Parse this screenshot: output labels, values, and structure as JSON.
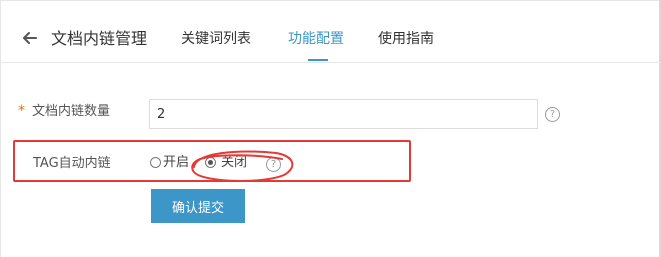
{
  "header": {
    "title": "文档内链管理",
    "tabs": [
      {
        "label": "关键词列表"
      },
      {
        "label": "功能配置"
      },
      {
        "label": "使用指南"
      }
    ]
  },
  "form": {
    "link_count": {
      "required_mark": "*",
      "label": "文档内链数量",
      "value": "2",
      "help_glyph": "?"
    },
    "tag_autolink": {
      "label": "TAG自动内链",
      "options": [
        {
          "label": "开启",
          "selected": false
        },
        {
          "label": "关闭",
          "selected": true
        }
      ],
      "help_glyph": "?"
    },
    "submit_label": "确认提交"
  },
  "colors": {
    "accent": "#3d96c8",
    "annotation": "#e53935",
    "required": "#f56c00"
  },
  "icons": {
    "back": "arrow-left-icon",
    "help": "question-circle-icon"
  }
}
